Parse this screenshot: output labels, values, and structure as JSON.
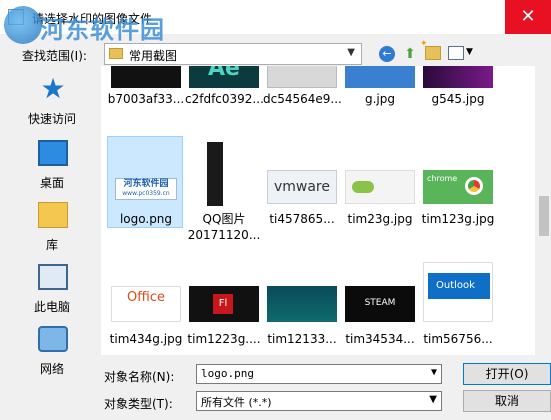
{
  "window": {
    "title": "请选择水印的图像文件",
    "close_glyph": "✕"
  },
  "watermark": {
    "title": "河东软件园",
    "url": "www.pc0359.cn"
  },
  "lookin": {
    "label": "查找范围(I):",
    "value": "常用截图"
  },
  "places": [
    {
      "label": "快速访问",
      "icon": "quick-access-star-icon"
    },
    {
      "label": "桌面",
      "icon": "desktop-icon"
    },
    {
      "label": "库",
      "icon": "library-icon"
    },
    {
      "label": "此电脑",
      "icon": "computer-icon"
    },
    {
      "label": "网络",
      "icon": "network-icon"
    }
  ],
  "files": [
    {
      "name": "b7003af33...",
      "thumb": "dark-image"
    },
    {
      "name": "c2fdfc0392...",
      "thumb": "adobe-teal"
    },
    {
      "name": "dc54564e9...",
      "thumb": "gray"
    },
    {
      "name": "g.jpg",
      "thumb": "blue-image"
    },
    {
      "name": "g545.jpg",
      "thumb": "purple-image"
    },
    {
      "name": "logo.png",
      "thumb": "logo",
      "selected": true,
      "logo_text": "河东软件园",
      "logo_url": "www.pc0359.cn"
    },
    {
      "name": "QQ图片",
      "name2": "20171120...",
      "thumb": "dark-menu"
    },
    {
      "name": "ti457865...",
      "thumb": "vmware",
      "thumb_text": "vmware"
    },
    {
      "name": "tim23g.jpg",
      "thumb": "green-yes"
    },
    {
      "name": "tim123g.jpg",
      "thumb": "chrome",
      "thumb_text": "chrome"
    },
    {
      "name": "tim434g.jpg",
      "thumb": "office",
      "thumb_text": "Office"
    },
    {
      "name": "tim1223g....",
      "thumb": "flash-red",
      "thumb_text": "Fl"
    },
    {
      "name": "tim12133...",
      "thumb": "concert"
    },
    {
      "name": "tim34534...",
      "thumb": "steam",
      "thumb_text": "STEAM"
    },
    {
      "name": "tim56756...",
      "thumb": "outlook",
      "thumb_text": "Outlook"
    }
  ],
  "filename": {
    "label": "对象名称(N):",
    "value": "logo.png"
  },
  "filetype": {
    "label": "对象类型(T):",
    "value": "所有文件 (*.*)"
  },
  "buttons": {
    "open": "打开(O)",
    "cancel": "取消"
  }
}
